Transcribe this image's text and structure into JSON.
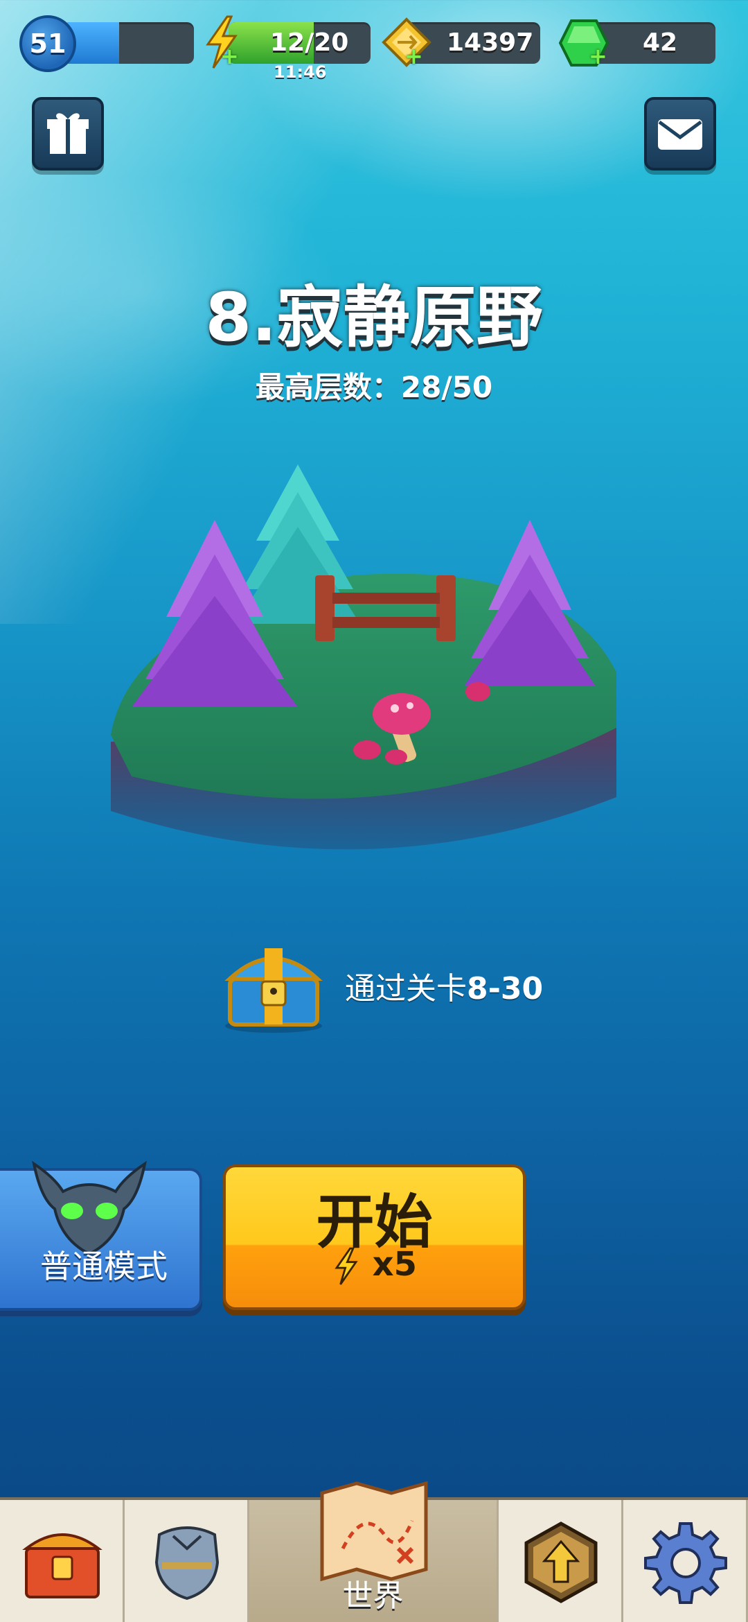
{
  "hud": {
    "level": "51",
    "xp_fraction": 0.43,
    "energy": "12/20",
    "energy_fraction": 0.6,
    "energy_timer": "11:46",
    "gold": "14397",
    "gems": "42"
  },
  "stage": {
    "title_number": "8.",
    "title_name": "寂静原野",
    "max_floors": "最高层数：28/50"
  },
  "reward": {
    "prefix": "通过关卡",
    "level": "8-30"
  },
  "mode_button": {
    "label": "普通模式"
  },
  "start_button": {
    "label": "开始",
    "cost": "x5"
  },
  "nav": {
    "items": [
      {
        "icon": "chest-icon"
      },
      {
        "icon": "armor-icon"
      },
      {
        "icon": "map-icon",
        "label": "世界"
      },
      {
        "icon": "upgrade-icon"
      },
      {
        "icon": "gear-icon"
      }
    ]
  },
  "colors": {
    "energy_green": "#2fa12d",
    "xp_blue": "#1f7ad2",
    "start_yellow": "#ffc81c",
    "mode_blue": "#2f74d0"
  }
}
